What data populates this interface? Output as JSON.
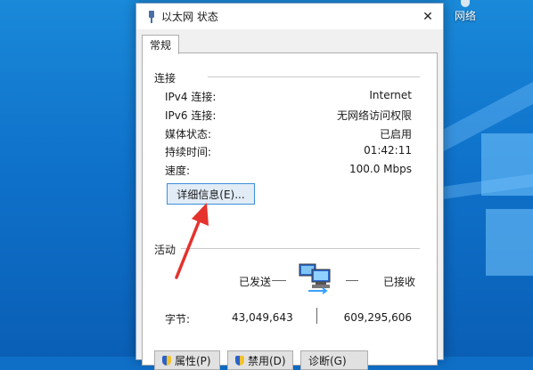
{
  "desktop": {
    "network_icon_label": "网络"
  },
  "window": {
    "title": "以太网 状态",
    "close_glyph": "✕",
    "tab_label": "常规"
  },
  "connection": {
    "group_title": "连接",
    "rows": [
      {
        "label": "IPv4 连接:",
        "value": "Internet"
      },
      {
        "label": "IPv6 连接:",
        "value": "无网络访问权限"
      },
      {
        "label": "媒体状态:",
        "value": "已启用"
      },
      {
        "label": "持续时间:",
        "value": "01:42:11"
      },
      {
        "label": "速度:",
        "value": "100.0 Mbps"
      }
    ],
    "details_button": "详细信息(E)..."
  },
  "activity": {
    "group_title": "活动",
    "sent_label": "已发送",
    "received_label": "已接收",
    "bytes_label": "字节:",
    "bytes_sent": "43,049,643",
    "bytes_received": "609,295,606"
  },
  "buttons": {
    "properties": "属性(P)",
    "disable": "禁用(D)",
    "diagnose": "诊断(G)"
  },
  "colors": {
    "annotation_arrow": "#e5322d",
    "focus_border": "#3c8fd8"
  }
}
